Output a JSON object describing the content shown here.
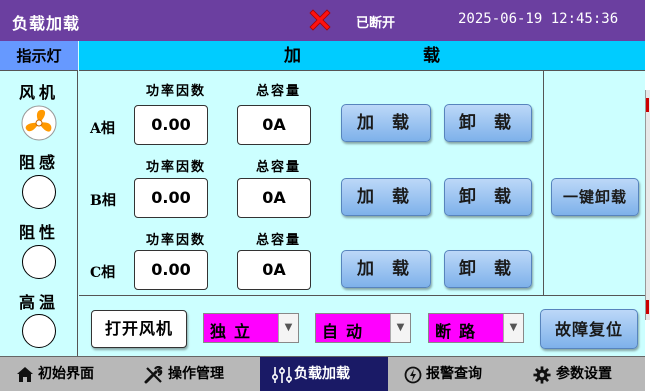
{
  "window": {
    "title": "负载加载",
    "connection_status": "已断开",
    "datetime": "2025-06-19 12:45:36",
    "status_icon": "red-x-icon"
  },
  "indicators": {
    "header": "指示灯",
    "items": [
      {
        "label": "风机",
        "state": "on",
        "icon": "fan-icon"
      },
      {
        "label": "阻感",
        "state": "off"
      },
      {
        "label": "阻性",
        "state": "off"
      },
      {
        "label": "高温",
        "state": "off"
      }
    ]
  },
  "main": {
    "header": "加 载",
    "col_power_factor": "功率因数",
    "col_total_capacity": "总容量",
    "load_label": "加 载",
    "unload_label": "卸 载",
    "phases": [
      {
        "label": "A相",
        "power_factor": "0.00",
        "total_capacity": "0A"
      },
      {
        "label": "B相",
        "power_factor": "0.00",
        "total_capacity": "0A"
      },
      {
        "label": "C相",
        "power_factor": "0.00",
        "total_capacity": "0A"
      }
    ],
    "one_key_unload": "一键卸载"
  },
  "controls": {
    "fan_button": "打开风机",
    "selects": [
      {
        "value": "独立",
        "color": "#ff00ff"
      },
      {
        "value": "自动",
        "color": "#ff00ff"
      },
      {
        "value": "断路",
        "color": "#ff00ff"
      }
    ],
    "reset_button": "故障复位"
  },
  "nav": {
    "items": [
      {
        "label": "初始界面",
        "icon": "home-icon",
        "active": false
      },
      {
        "label": "操作管理",
        "icon": "tools-icon",
        "active": false
      },
      {
        "label": "负载加载",
        "icon": "sliders-icon",
        "active": true
      },
      {
        "label": "报警查询",
        "icon": "alarm-icon",
        "active": false
      },
      {
        "label": "参数设置",
        "icon": "gear-icon",
        "active": false
      }
    ]
  },
  "colors": {
    "title_bar": "#6b3fa0",
    "panel_bg": "#ccffff",
    "main_header": "#00ccff",
    "indicator_header": "#6699ff",
    "select_bg": "#ff00ff",
    "nav_active": "#1a1a66",
    "button_blue": "#7eb1ea"
  }
}
